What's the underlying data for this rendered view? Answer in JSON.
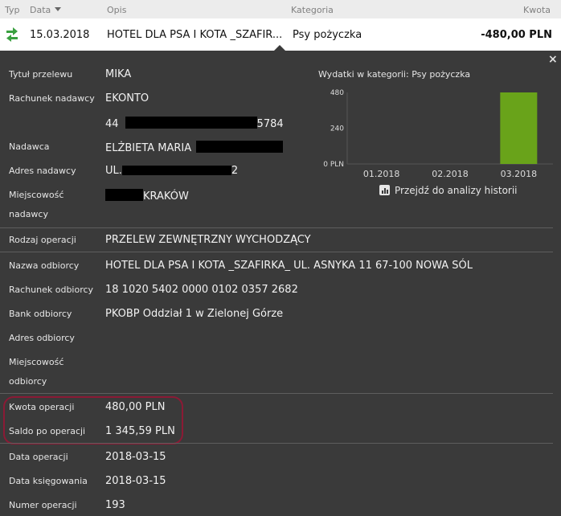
{
  "header": {
    "col_typ": "Typ",
    "col_data": "Data",
    "col_opis": "Opis",
    "col_kategoria": "Kategoria",
    "col_kwota": "Kwota"
  },
  "transaction": {
    "date": "15.03.2018",
    "description": "HOTEL DLA PSA I KOTA _SZAFIR...",
    "category": "Psy pożyczka",
    "amount": "-480,00 PLN"
  },
  "close_label": "×",
  "details": {
    "tytul_label": "Tytuł przelewu",
    "tytul": "MIKA",
    "rachunek_nad_label": "Rachunek nadawcy",
    "rachunek_nad_1": "EKONTO",
    "rachunek_nad_2a": "44",
    "rachunek_nad_2b": "5784",
    "nadawca_label": "Nadawca",
    "nadawca": "ELŻBIETA MARIA",
    "adres_nad_label": "Adres nadawcy",
    "adres_nad_a": "UL.",
    "adres_nad_b": "2",
    "miejsc_nad_label_1": "Miejscowość",
    "miejsc_nad_label_2": "nadawcy",
    "miejsc_nad": "KRAKÓW",
    "rodzaj_label": "Rodzaj operacji",
    "rodzaj": "PRZELEW ZEWNĘTRZNY WYCHODZĄCY",
    "nazwa_odb_label": "Nazwa odbiorcy",
    "nazwa_odb": "HOTEL DLA PSA I KOTA _SZAFIRKA_ UL. ASNYKA 11 67-100 NOWA SÓL",
    "rachunek_odb_label": "Rachunek odbiorcy",
    "rachunek_odb": "18 1020 5402 0000 0102 0357 2682",
    "bank_odb_label": "Bank odbiorcy",
    "bank_odb": "PKOBP Oddział 1 w Zielonej Górze",
    "adres_odb_label": "Adres odbiorcy",
    "miejsc_odb_label_1": "Miejscowość",
    "miejsc_odb_label_2": "odbiorcy",
    "kwota_label": "Kwota operacji",
    "kwota": "480,00 PLN",
    "saldo_label": "Saldo po operacji",
    "saldo": "1 345,59 PLN",
    "data_op_label": "Data operacji",
    "data_op": "2018-03-15",
    "data_ks_label": "Data księgowania",
    "data_ks": "2018-03-15",
    "numer_label": "Numer operacji",
    "numer": "193"
  },
  "chart_title": "Wydatki w kategorii:  Psy pożyczka",
  "chart_link": "Przejdź do analizy historii",
  "colors": {
    "bar": "#69a31a",
    "highlight_oval": "#8b1a35",
    "sort_icon": "#3aa040"
  },
  "chart_data": {
    "type": "bar",
    "categories": [
      "01.2018",
      "02.2018",
      "03.2018"
    ],
    "values": [
      0,
      0,
      480
    ],
    "ylim": [
      0,
      480
    ],
    "yticks": [
      "480",
      "240",
      "0 PLN"
    ],
    "title": "Wydatki w kategorii:  Psy pożyczka"
  }
}
